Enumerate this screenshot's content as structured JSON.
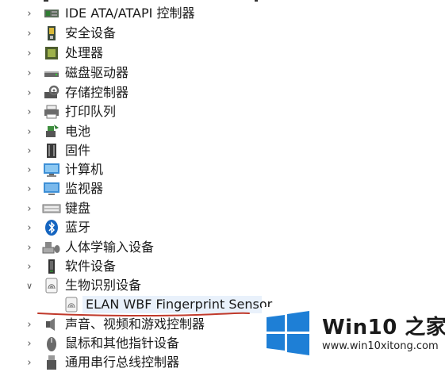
{
  "device_tree": {
    "items": [
      {
        "label": "IDE ATA/ATAPI 控制器",
        "icon": "ide-controller-icon",
        "expanded": false
      },
      {
        "label": "安全设备",
        "icon": "security-device-icon",
        "expanded": false
      },
      {
        "label": "处理器",
        "icon": "processor-icon",
        "expanded": false
      },
      {
        "label": "磁盘驱动器",
        "icon": "disk-drive-icon",
        "expanded": false
      },
      {
        "label": "存储控制器",
        "icon": "storage-controller-icon",
        "expanded": false
      },
      {
        "label": "打印队列",
        "icon": "print-queue-icon",
        "expanded": false
      },
      {
        "label": "电池",
        "icon": "battery-icon",
        "expanded": false
      },
      {
        "label": "固件",
        "icon": "firmware-icon",
        "expanded": false
      },
      {
        "label": "计算机",
        "icon": "computer-icon",
        "expanded": false
      },
      {
        "label": "监视器",
        "icon": "monitor-icon",
        "expanded": false
      },
      {
        "label": "键盘",
        "icon": "keyboard-icon",
        "expanded": false
      },
      {
        "label": "蓝牙",
        "icon": "bluetooth-icon",
        "expanded": false
      },
      {
        "label": "人体学输入设备",
        "icon": "hid-icon",
        "expanded": false
      },
      {
        "label": "软件设备",
        "icon": "software-device-icon",
        "expanded": false
      },
      {
        "label": "生物识别设备",
        "icon": "biometric-icon",
        "expanded": true
      },
      {
        "label": "ELAN WBF Fingerprint Sensor",
        "icon": "fingerprint-icon",
        "child": true
      },
      {
        "label": "声音、视频和游戏控制器",
        "icon": "sound-icon",
        "expanded": false
      },
      {
        "label": "鼠标和其他指针设备",
        "icon": "mouse-icon",
        "expanded": false
      },
      {
        "label": "通用串行总线控制器",
        "icon": "usb-icon",
        "expanded": false
      }
    ]
  },
  "watermark": {
    "title": "Win10 之家",
    "url": "www.win10xitong.com"
  },
  "colors": {
    "win_blue": "#1e7fd6",
    "underline_red": "#c0392b",
    "selection": "#e9f1fb"
  }
}
